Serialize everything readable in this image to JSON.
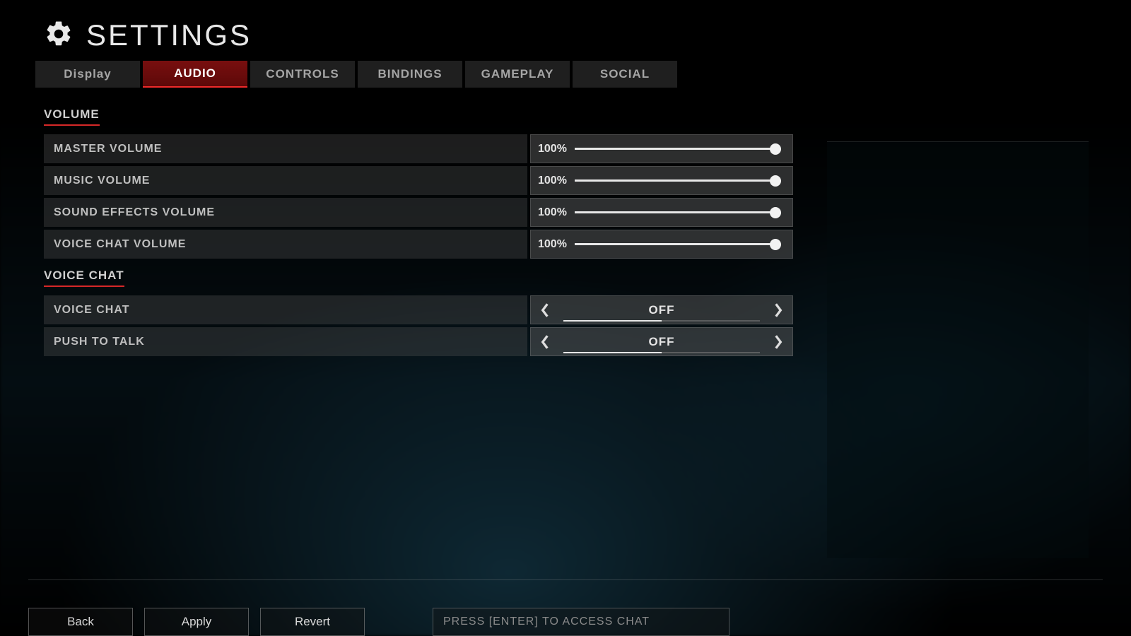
{
  "header": {
    "title": "SETTINGS"
  },
  "tabs": [
    {
      "label": "Display",
      "active": false
    },
    {
      "label": "AUDIO",
      "active": true
    },
    {
      "label": "CONTROLS",
      "active": false
    },
    {
      "label": "BINDINGS",
      "active": false
    },
    {
      "label": "GAMEPLAY",
      "active": false
    },
    {
      "label": "SOCIAL",
      "active": false
    }
  ],
  "sections": {
    "volume": {
      "title": "VOLUME",
      "rows": [
        {
          "label": "MASTER VOLUME",
          "value": "100%",
          "percent": 100
        },
        {
          "label": "MUSIC VOLUME",
          "value": "100%",
          "percent": 100
        },
        {
          "label": "SOUND EFFECTS VOLUME",
          "value": "100%",
          "percent": 100
        },
        {
          "label": "VOICE CHAT VOLUME",
          "value": "100%",
          "percent": 100
        }
      ]
    },
    "voice": {
      "title": "VOICE CHAT",
      "rows": [
        {
          "label": "VOICE CHAT",
          "value": "OFF",
          "index": 0,
          "count": 2
        },
        {
          "label": "PUSH TO TALK",
          "value": "OFF",
          "index": 0,
          "count": 2
        }
      ]
    }
  },
  "footer": {
    "back": "Back",
    "apply": "Apply",
    "revert": "Revert",
    "chat_placeholder": "PRESS [ENTER] TO ACCESS CHAT"
  },
  "colors": {
    "accent": "#d62828",
    "text": "#e4e4e4"
  }
}
